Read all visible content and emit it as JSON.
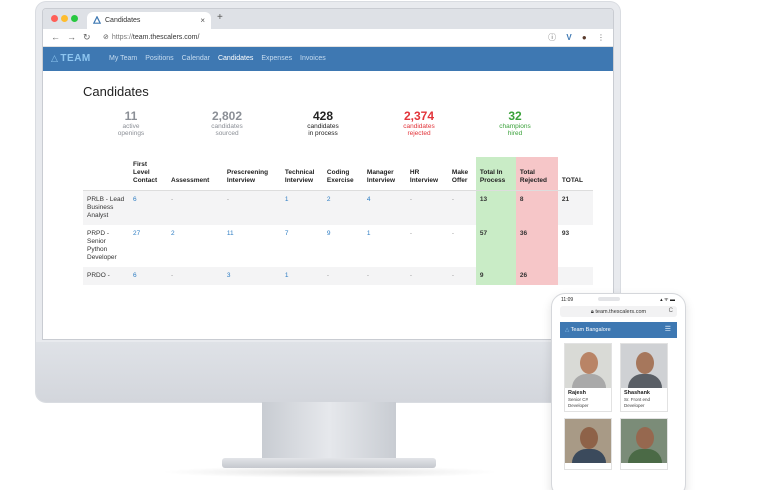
{
  "browser": {
    "tab_title": "Candidates",
    "tab_close": "×",
    "new_tab": "+",
    "url_scheme": "https://",
    "url_host": "team.thescalers.com/"
  },
  "app": {
    "brand": "TEAM",
    "menu": [
      "My Team",
      "Positions",
      "Calendar",
      "Candidates",
      "Expenses",
      "Invoices"
    ],
    "active_menu": "Candidates",
    "page_title": "Candidates"
  },
  "stats": [
    {
      "num": "11",
      "l1": "active",
      "l2": "openings",
      "tone": "grey"
    },
    {
      "num": "2,802",
      "l1": "candidates",
      "l2": "sourced",
      "tone": "grey"
    },
    {
      "num": "428",
      "l1": "candidates",
      "l2": "in process",
      "tone": "dark"
    },
    {
      "num": "2,374",
      "l1": "candidates",
      "l2": "rejected",
      "tone": "red"
    },
    {
      "num": "32",
      "l1": "champions",
      "l2": "hired",
      "tone": "green"
    }
  ],
  "table": {
    "headers": [
      "",
      "First Level Contact",
      "Assessment",
      "Prescreening Interview",
      "Technical Interview",
      "Coding Exercise",
      "Manager Interview",
      "HR Interview",
      "Make Offer",
      "Total In Process",
      "Total Rejected",
      "TOTAL"
    ],
    "rows": [
      {
        "position": "PRLB - Lead Business Analyst",
        "cells": [
          "6",
          "-",
          "-",
          "1",
          "2",
          "4",
          "-",
          "-",
          "13",
          "8",
          "21"
        ]
      },
      {
        "position": "PRPD - Senior Python Developer",
        "cells": [
          "27",
          "2",
          "11",
          "7",
          "9",
          "1",
          "-",
          "-",
          "57",
          "36",
          "93"
        ]
      },
      {
        "position": "PRDO -",
        "cells": [
          "6",
          "-",
          "3",
          "1",
          "-",
          "-",
          "-",
          "-",
          "9",
          "26",
          ""
        ]
      }
    ]
  },
  "phone": {
    "time": "11:09",
    "status_right": "▴ ᯤ ▬",
    "url": "team.thescalers.com",
    "reload": "C",
    "nav_title": "Team Bangalore",
    "cards": [
      {
        "name": "Rajesh",
        "role": "Senior C# Developer",
        "skin": "#b98466",
        "shirt": "#a9a9a9",
        "bg": "#d9dad6"
      },
      {
        "name": "Shashank",
        "role": "Sr. Front end Developer",
        "skin": "#a6775c",
        "shirt": "#5a5f66",
        "bg": "#cfd1d4"
      },
      {
        "name": "",
        "role": "",
        "skin": "#8e6248",
        "shirt": "#3b4a5c",
        "bg": "#a89a86"
      },
      {
        "name": "",
        "role": "",
        "skin": "#96684f",
        "shirt": "#4b6a46",
        "bg": "#7b8c78"
      }
    ]
  },
  "colors": {
    "navbar": "#3e78b2",
    "link": "#2c7cc3",
    "red": "#e2343a",
    "green": "#3aa13a",
    "in_process_col": "#c9ecc6",
    "rejected_col": "#f6c6c8"
  }
}
